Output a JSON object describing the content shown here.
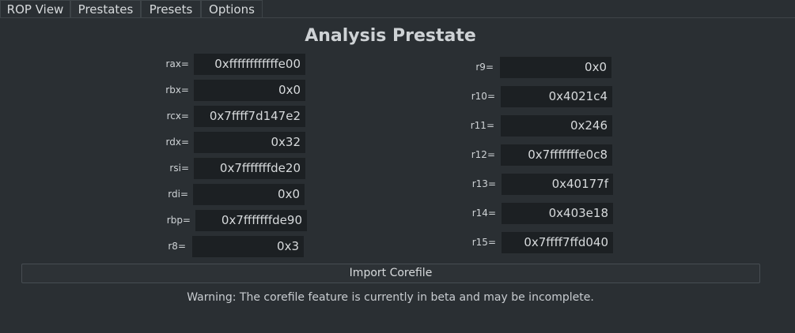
{
  "tabs": [
    {
      "label": "ROP View"
    },
    {
      "label": "Prestates"
    },
    {
      "label": "Presets"
    },
    {
      "label": "Options"
    }
  ],
  "active_tab": "Prestates",
  "title": "Analysis Prestate",
  "registers_left": [
    {
      "label": "rax=",
      "value": "0xffffffffffffe00"
    },
    {
      "label": "rbx=",
      "value": "0x0"
    },
    {
      "label": "rcx=",
      "value": "0x7ffff7d147e2"
    },
    {
      "label": "rdx=",
      "value": "0x32"
    },
    {
      "label": "rsi=",
      "value": "0x7fffffffde20"
    },
    {
      "label": "rdi=",
      "value": "0x0"
    },
    {
      "label": "rbp=",
      "value": "0x7fffffffde90"
    },
    {
      "label": "r8=",
      "value": "0x3"
    }
  ],
  "registers_right": [
    {
      "label": "r9=",
      "value": "0x0"
    },
    {
      "label": "r10=",
      "value": "0x4021c4"
    },
    {
      "label": "r11=",
      "value": "0x246"
    },
    {
      "label": "r12=",
      "value": "0x7fffffffe0c8"
    },
    {
      "label": "r13=",
      "value": "0x40177f"
    },
    {
      "label": "r14=",
      "value": "0x403e18"
    },
    {
      "label": "r15=",
      "value": "0x7ffff7ffd040"
    }
  ],
  "import_button": "Import Corefile",
  "warning": "Warning: The corefile feature is currently in beta and may be incomplete."
}
